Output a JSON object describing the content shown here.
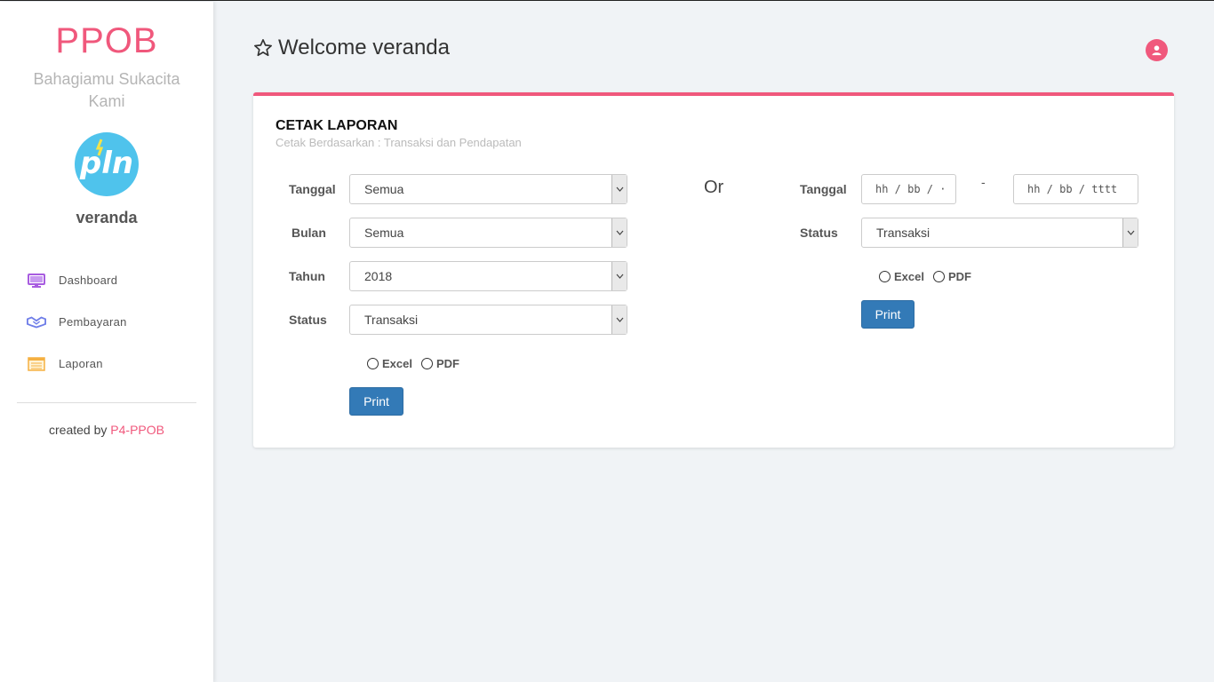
{
  "sidebar": {
    "brand": "PPOB",
    "tagline": "Bahagiamu Sukacita Kami",
    "logo_text": "pln",
    "username": "veranda",
    "items": [
      {
        "label": "Dashboard",
        "icon": "monitor-icon",
        "color": "#a85ce0"
      },
      {
        "label": "Pembayaran",
        "icon": "handshake-icon",
        "color": "#6f7ee8"
      },
      {
        "label": "Laporan",
        "icon": "list-icon",
        "color": "#f5b041"
      }
    ],
    "credit_prefix": "created by ",
    "credit_link": "P4-PPOB"
  },
  "header": {
    "welcome": "Welcome veranda"
  },
  "card": {
    "title": "CETAK LAPORAN",
    "subtitle": "Cetak Berdasarkan : Transaksi dan Pendapatan",
    "left": {
      "tanggal_label": "Tanggal",
      "tanggal_value": "Semua",
      "bulan_label": "Bulan",
      "bulan_value": "Semua",
      "tahun_label": "Tahun",
      "tahun_value": "2018",
      "status_label": "Status",
      "status_value": "Transaksi",
      "excel_label": "Excel",
      "pdf_label": "PDF",
      "print_label": "Print"
    },
    "or_label": "Or",
    "right": {
      "tanggal_label": "Tanggal",
      "date_from": "hh / bb / ·",
      "separator": "-",
      "date_to": "hh / bb / tttt",
      "status_label": "Status",
      "status_value": "Transaksi",
      "excel_label": "Excel",
      "pdf_label": "PDF",
      "print_label": "Print"
    }
  },
  "colors": {
    "accent": "#f0587c",
    "primary_button": "#337ab7",
    "logo_bg": "#4fc3ec"
  }
}
